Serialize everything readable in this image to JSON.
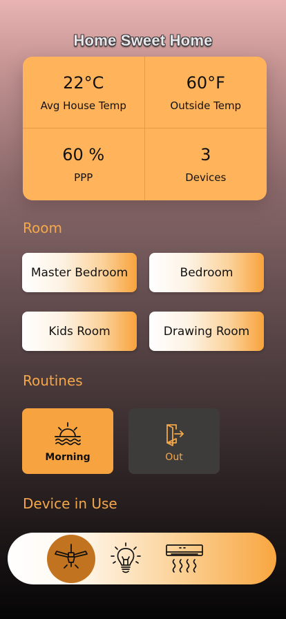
{
  "header": {
    "title": "Home Sweet Home"
  },
  "stats": [
    {
      "value": "22°C",
      "label": "Avg House Temp"
    },
    {
      "value": "60°F",
      "label": "Outside Temp"
    },
    {
      "value": "60 %",
      "label": "PPP"
    },
    {
      "value": "3",
      "label": "Devices"
    }
  ],
  "rooms": {
    "heading": "Room",
    "items": [
      "Master Bedroom",
      "Bedroom",
      "Kids Room",
      "Drawing Room"
    ]
  },
  "routines": {
    "heading": "Routines",
    "items": [
      {
        "label": "Morning",
        "icon": "sunrise-icon",
        "active": true
      },
      {
        "label": "Out",
        "icon": "exit-door-icon",
        "active": false
      }
    ]
  },
  "devices": {
    "heading": "Device in Use",
    "items": [
      {
        "icon": "ceiling-fan-icon",
        "active": true
      },
      {
        "icon": "light-bulb-icon",
        "active": false
      },
      {
        "icon": "air-conditioner-icon",
        "active": false
      }
    ]
  },
  "colors": {
    "accent": "#f7a33f",
    "card": "#ffb35a",
    "section_text": "#f5a84a",
    "inactive_routine": "#3d3c3b",
    "active_device_bg": "#c1731f"
  }
}
